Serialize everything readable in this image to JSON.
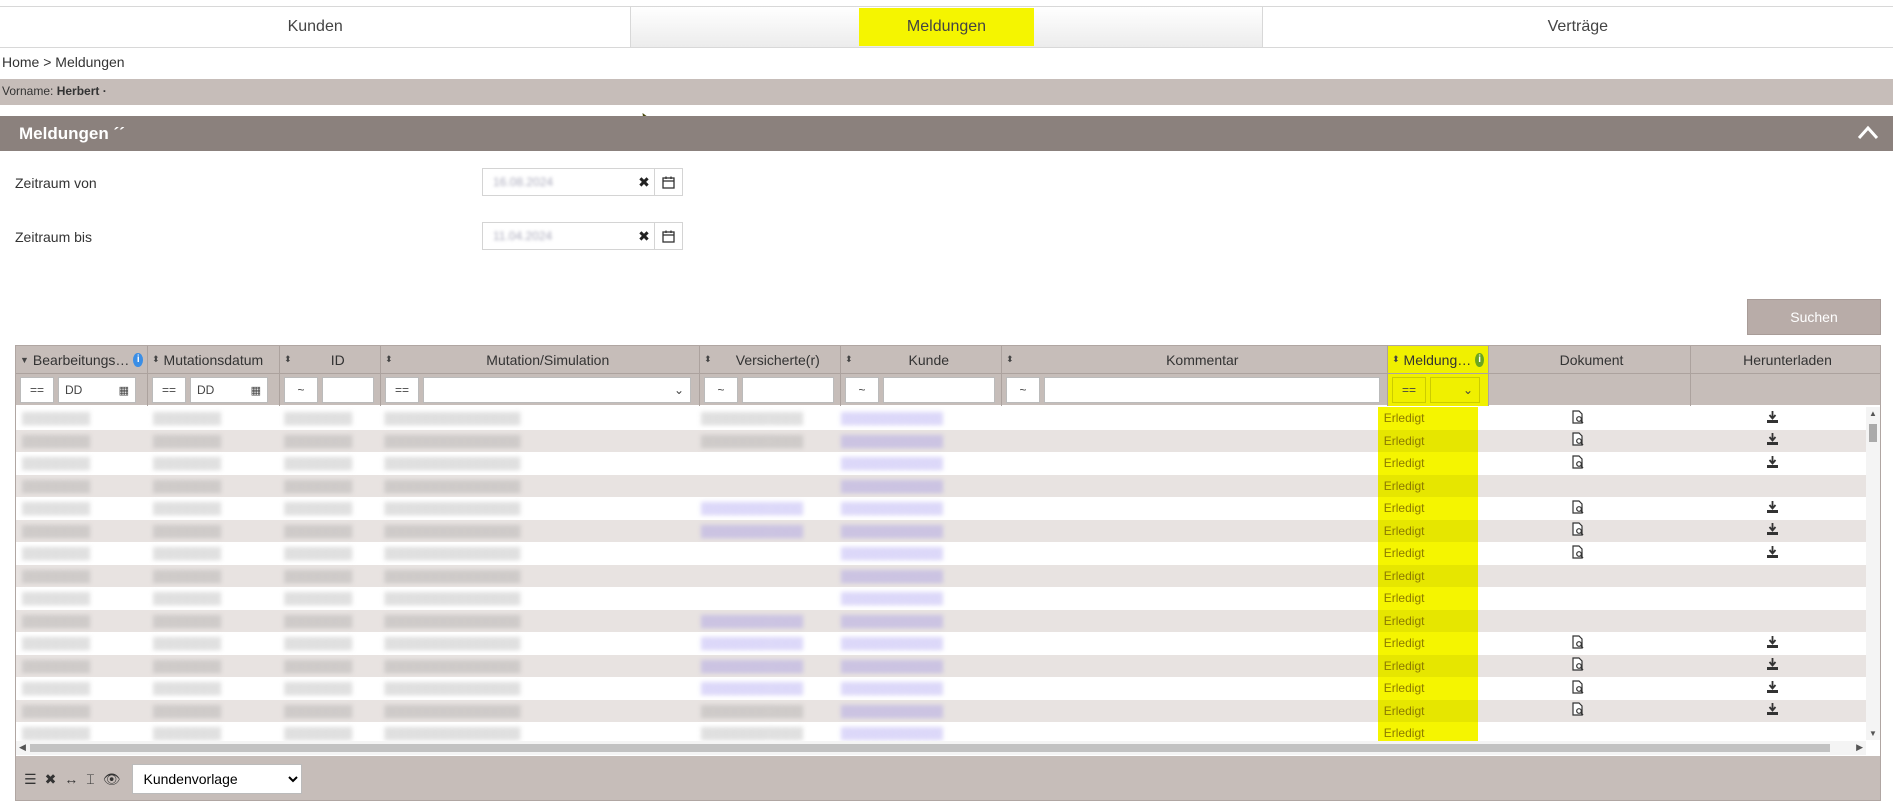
{
  "tabs": [
    {
      "label": "Kunden"
    },
    {
      "label": "Meldungen",
      "active": true
    },
    {
      "label": "Verträge"
    }
  ],
  "breadcrumb": "Home > Meldungen",
  "vorname": {
    "label": "Vorname:",
    "value": "Herbert ·"
  },
  "section": {
    "title": "Meldungen ´´"
  },
  "form": {
    "zeitraum_von_label": "Zeitraum von",
    "zeitraum_von_value": "16.08.2024",
    "zeitraum_bis_label": "Zeitraum bis",
    "zeitraum_bis_value": "11.04.2024"
  },
  "search_label": "Suchen",
  "columns": [
    {
      "label": "Bearbeitungs…"
    },
    {
      "label": "Mutationsdatum"
    },
    {
      "label": "ID"
    },
    {
      "label": "Mutation/Simulation"
    },
    {
      "label": "Versicherte(r)"
    },
    {
      "label": "Kunde"
    },
    {
      "label": "Kommentar"
    },
    {
      "label": "Meldung…"
    },
    {
      "label": "Dokument"
    },
    {
      "label": "Herunterladen"
    }
  ],
  "filters": {
    "op_eq": "==",
    "op_like": "~",
    "date_placeholder": "DD"
  },
  "status_label": "Erledigt",
  "rows": [
    {
      "doc": true,
      "dl": true,
      "vers": "t",
      "kunde": "l"
    },
    {
      "doc": true,
      "dl": true,
      "vers": "t",
      "kunde": "l"
    },
    {
      "doc": true,
      "dl": true,
      "vers": "",
      "kunde": "l"
    },
    {
      "doc": false,
      "dl": false,
      "vers": "",
      "kunde": "l"
    },
    {
      "doc": true,
      "dl": true,
      "vers": "l",
      "kunde": "l"
    },
    {
      "doc": true,
      "dl": true,
      "vers": "l",
      "kunde": "l"
    },
    {
      "doc": true,
      "dl": true,
      "vers": "",
      "kunde": "l"
    },
    {
      "doc": false,
      "dl": false,
      "vers": "",
      "kunde": "l"
    },
    {
      "doc": false,
      "dl": false,
      "vers": "",
      "kunde": "l"
    },
    {
      "doc": false,
      "dl": false,
      "vers": "l",
      "kunde": "l"
    },
    {
      "doc": true,
      "dl": true,
      "vers": "l",
      "kunde": "l"
    },
    {
      "doc": true,
      "dl": true,
      "vers": "l",
      "kunde": "l"
    },
    {
      "doc": true,
      "dl": true,
      "vers": "l",
      "kunde": "l"
    },
    {
      "doc": true,
      "dl": true,
      "vers": "t",
      "kunde": "l"
    },
    {
      "doc": false,
      "dl": false,
      "vers": "t",
      "kunde": "l"
    }
  ],
  "footer": {
    "template_label": "Kundenvorlage"
  },
  "colors": {
    "highlight": "#f5f500",
    "header_bg": "#c6bdb9",
    "section_bg": "#8b817d"
  }
}
